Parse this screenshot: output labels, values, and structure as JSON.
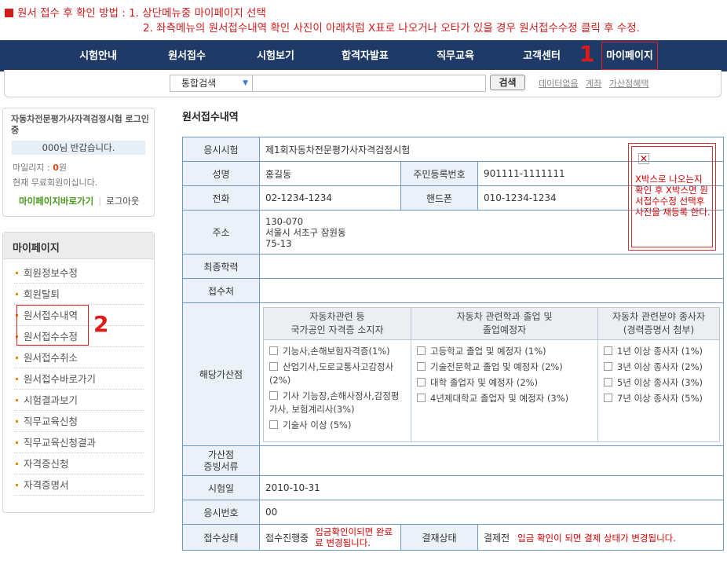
{
  "instructions": {
    "line1": "원서 접수 후 확인 방법 : 1. 상단메뉴중 마이페이지 선택",
    "line2": "2. 좌측메뉴의 원서접수내역 확인 사진이 아래처럼 X표로 나오거나 오타가 있을 경우 원서접수수정 클릭 후 수정."
  },
  "nav": {
    "items": [
      "시험안내",
      "원서접수",
      "시험보기",
      "합격자발표",
      "직무교육",
      "고객센터",
      "마이페이지"
    ],
    "step_number": "1"
  },
  "search": {
    "scope": "통합검색",
    "button": "검색",
    "links": [
      "데이터없음",
      "계좌",
      "가산점혜택"
    ]
  },
  "login": {
    "title": "자동차전문평가사자격검정시험 로그인중",
    "greeting": "000님 반갑습니다.",
    "mileage_label": "마일리지 : ",
    "mileage_value": "0",
    "mileage_unit": "원",
    "member_status": "현재 무료회원이십니다.",
    "mypage_link": "마이페이지바로가기",
    "logout": "로그아웃"
  },
  "sidebar": {
    "title": "마이페이지",
    "items": [
      "회원정보수정",
      "회원탈퇴",
      "원서접수내역",
      "원서접수수정",
      "원서접수취소",
      "원서접수바로가기",
      "시험결과보기",
      "직무교육신청",
      "직무교육신청결과",
      "자격증신청",
      "자격증명서"
    ],
    "step_number": "2"
  },
  "content": {
    "title": "원서접수내역",
    "photo_note": "X박스로 나오는지 확인 후 X박스면 원서접수수정 선택후 사진을 재등록 한다.",
    "rows": {
      "exam_label": "응시시험",
      "exam_value": "제1회자동차전문평가사자격검정시험",
      "name_label": "성명",
      "name_value": "홍길동",
      "rrn_label": "주민등록번호",
      "rrn_value": "901111-1111111",
      "phone_label": "전화",
      "phone_value": "02-1234-1234",
      "mobile_label": "핸드폰",
      "mobile_value": "010-1234-1234",
      "address_label": "주소",
      "address_zip": "130-070",
      "address_line1": "서울시 서초구 잠원동",
      "address_line2": "75-13",
      "education_label": "최종학력",
      "venue_label": "접수처",
      "bonus_label": "해당가산점",
      "bonus_doc_label_1": "가산점",
      "bonus_doc_label_2": "증빙서류",
      "exam_date_label": "시험일",
      "exam_date_value": "2010-10-31",
      "exam_number_label": "응시번호",
      "exam_number_value": "00",
      "status_label": "접수상태",
      "status_value": "접수진행중",
      "status_note": "입금확인이되면 완료료 변경됩니다.",
      "payment_label": "결재상태",
      "payment_value": "결제전",
      "payment_note": "입금 확인이 되면 결제 상태가 변경됩니다."
    },
    "bonus_columns": [
      {
        "header1": "자동차관련 등",
        "header2": "국가공인 자격증 소지자",
        "options": [
          "기능사,손해보험자격증(1%)",
          "산업기사,도로교통사고감정사(2%)",
          "기사 기능장,손해사정사,감정평가사, 보험계리사(3%)",
          "기술사 이상 (5%)"
        ]
      },
      {
        "header1": "자동차 관련학과 졸업 및",
        "header2": "졸업예정자",
        "options": [
          "고등학교 졸업 및 예정자 (1%)",
          "기술전문학교 졸업 및 예정자 (2%)",
          "대학 졸업자 및 예정자 (2%)",
          "4년제대학교 졸업자 및 예정자 (3%)"
        ]
      },
      {
        "header1": "자동차 관련분야 종사자",
        "header2": "(경력증명서 첨부)",
        "options": [
          "1년 이상 종사자 (1%)",
          "3년 이상 종사자 (2%)",
          "5년 이상 종사자 (3%)",
          "7년 이상 종사자 (5%)"
        ]
      }
    ]
  },
  "colors": {
    "accent_red": "#d21c1c",
    "nav_bg": "#1f3a66",
    "table_border": "#6b97c9",
    "table_header_bg": "#eaf1f9"
  }
}
